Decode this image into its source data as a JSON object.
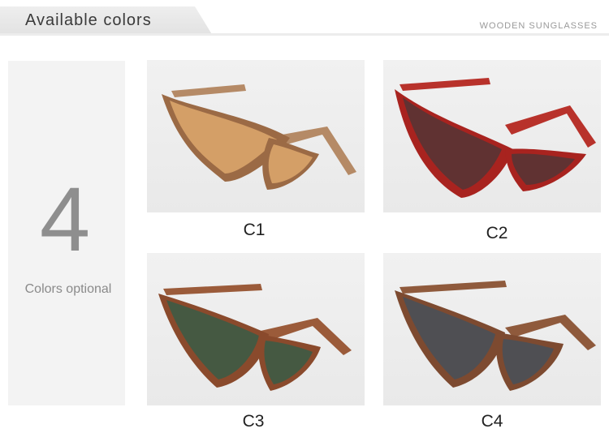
{
  "header": {
    "title": "Available colors",
    "subtitle": "WOODEN SUNGLASSES"
  },
  "side": {
    "count": "4",
    "label": "Colors optional"
  },
  "variants": [
    {
      "label": "C1",
      "frame_color": "#9b6a45",
      "temple_color": "#b58a66",
      "lens_color": "#d9a46a"
    },
    {
      "label": "C2",
      "frame_color": "#a8231f",
      "temple_color": "#b8322b",
      "lens_color": "#5a3434"
    },
    {
      "label": "C3",
      "frame_color": "#8a4a2c",
      "temple_color": "#9b5b3a",
      "lens_color": "#3f5a44"
    },
    {
      "label": "C4",
      "frame_color": "#7d4a30",
      "temple_color": "#8f5a3c",
      "lens_color": "#4b4f57"
    }
  ]
}
